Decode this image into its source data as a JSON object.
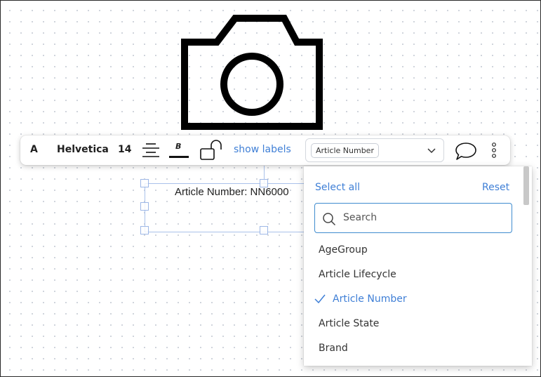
{
  "canvas": {
    "text_element": {
      "text": "Article Number: NN6000"
    }
  },
  "toolbar": {
    "font_icon_label": "A",
    "font_family": "Helvetica",
    "font_size": "14",
    "show_labels": "show labels",
    "attribute_select": {
      "value": "Article Number"
    },
    "icons": [
      "align-center-icon",
      "bold-icon",
      "unlock-icon",
      "chevron-down-icon",
      "comment-icon",
      "more-vertical-icon"
    ]
  },
  "dropdown": {
    "select_all": "Select all",
    "reset": "Reset",
    "search": {
      "placeholder": "Search",
      "value": ""
    },
    "items": [
      {
        "label": "AgeGroup",
        "selected": false
      },
      {
        "label": "Article Lifecycle",
        "selected": false
      },
      {
        "label": "Article Number",
        "selected": true
      },
      {
        "label": "Article State",
        "selected": false
      },
      {
        "label": "Brand",
        "selected": false
      }
    ]
  },
  "colors": {
    "accent": "#3f7fd6",
    "search_border": "#3f8ccf",
    "selection_frame": "#a9c1ea",
    "text": "#1f1f1f"
  }
}
